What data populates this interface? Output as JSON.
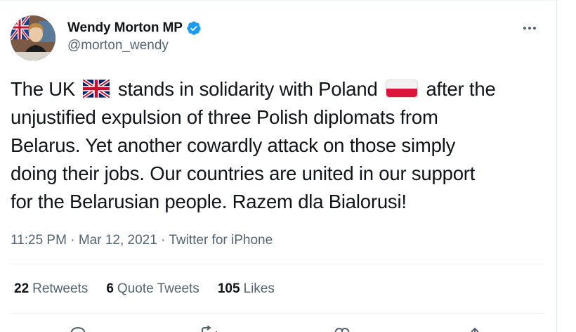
{
  "tweet": {
    "author": {
      "name": "Wendy Morton MP",
      "handle": "@morton_wendy",
      "verified": true
    },
    "text_lines": [
      [
        "The UK ",
        " stands in solidarity with Poland ",
        " after the"
      ],
      "unjustified expulsion of three Polish diplomats from",
      "Belarus. Yet another cowardly attack on those simply",
      "doing their jobs. Our countries are united in our support",
      "for the Belarusian people. Razem dla Bialorusi!"
    ],
    "emoji": [
      "uk-flag",
      "poland-flag"
    ],
    "time": "11:25 PM",
    "date": "Mar 12, 2021",
    "source": "Twitter for iPhone",
    "stats": {
      "retweets_count": "22",
      "retweets_label": "Retweets",
      "quotes_count": "6",
      "quotes_label": "Quote Tweets",
      "likes_count": "105",
      "likes_label": "Likes"
    },
    "actions": [
      "reply-icon",
      "retweet-icon",
      "like-icon",
      "share-icon"
    ]
  },
  "colors": {
    "text": "#0f1419",
    "secondary": "#536471",
    "verified": "#1d9bf0",
    "border": "#eff3f4"
  }
}
